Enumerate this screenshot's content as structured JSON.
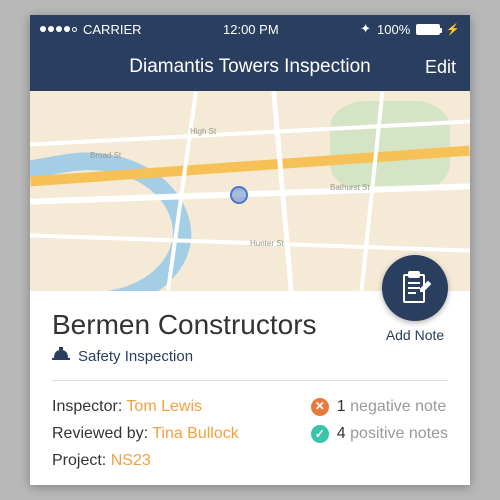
{
  "status_bar": {
    "carrier": "CARRIER",
    "time": "12:00 PM",
    "battery_pct": "100%"
  },
  "nav": {
    "title": "Diamantis Towers Inspection",
    "edit": "Edit"
  },
  "company": {
    "name": "Bermen Constructors",
    "inspection_type": "Safety Inspection"
  },
  "add_note": {
    "label": "Add Note"
  },
  "details": {
    "inspector_label": "Inspector: ",
    "inspector_value": "Tom Lewis",
    "reviewed_label": "Reviewed by: ",
    "reviewed_value": "Tina Bullock",
    "project_label": "Project: ",
    "project_value": "NS23"
  },
  "notes": {
    "negative_count": "1",
    "negative_text": "negative note",
    "positive_count": "4",
    "positive_text": "positive notes"
  }
}
